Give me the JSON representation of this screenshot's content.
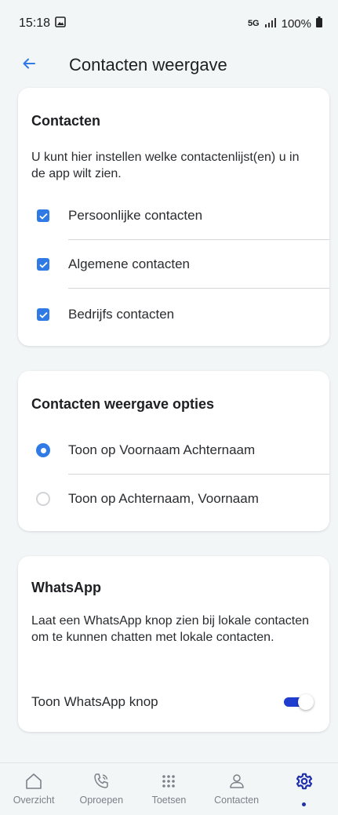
{
  "status_bar": {
    "time": "15:18",
    "network": "5G",
    "battery": "100%"
  },
  "header": {
    "title": "Contacten weergave"
  },
  "contacts_card": {
    "title": "Contacten",
    "description": "U kunt hier instellen welke contactenlijst(en) u in de app wilt zien.",
    "items": [
      {
        "label": "Persoonlijke contacten",
        "checked": true
      },
      {
        "label": "Algemene contacten",
        "checked": true
      },
      {
        "label": "Bedrijfs contacten",
        "checked": true
      }
    ]
  },
  "display_card": {
    "title": "Contacten weergave opties",
    "options": [
      {
        "label": "Toon op Voornaam Achternaam",
        "selected": true
      },
      {
        "label": "Toon op Achternaam, Voornaam",
        "selected": false
      }
    ]
  },
  "whatsapp_card": {
    "title": "WhatsApp",
    "description": "Laat een WhatsApp knop zien bij lokale contacten om te kunnen chatten met lokale contacten.",
    "toggle_label": "Toon WhatsApp knop",
    "toggle_on": true
  },
  "bottom_nav": {
    "items": [
      {
        "label": "Overzicht",
        "icon": "home-icon"
      },
      {
        "label": "Oproepen",
        "icon": "phone-icon"
      },
      {
        "label": "Toetsen",
        "icon": "dialpad-icon"
      },
      {
        "label": "Contacten",
        "icon": "person-icon"
      },
      {
        "label": "",
        "icon": "gear-icon",
        "active": true
      }
    ]
  },
  "colors": {
    "accent": "#2f7ae5",
    "toggle": "#1f3ecf",
    "background": "#f2f6f6"
  }
}
